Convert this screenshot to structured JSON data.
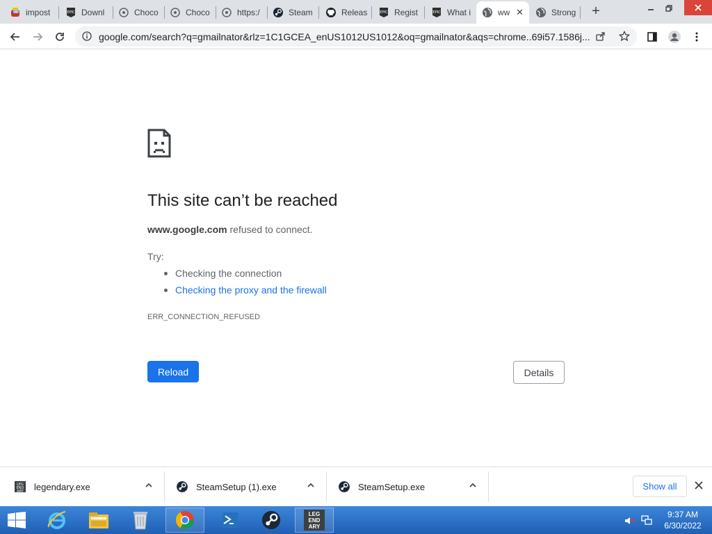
{
  "tabs": [
    {
      "title": "impost",
      "icon": "among-us-icon"
    },
    {
      "title": "Downl",
      "icon": "epic-games-icon"
    },
    {
      "title": "Choco",
      "icon": "chocolatey-icon"
    },
    {
      "title": "Choco",
      "icon": "chocolatey-icon"
    },
    {
      "title": "https:/",
      "icon": "chocolatey-icon"
    },
    {
      "title": "Steam",
      "icon": "steam-icon"
    },
    {
      "title": "Releas",
      "icon": "github-icon"
    },
    {
      "title": "Regist",
      "icon": "epic-games-icon"
    },
    {
      "title": "What i",
      "icon": "epic-games-icon"
    },
    {
      "title": "ww",
      "icon": "globe-icon",
      "active": true
    },
    {
      "title": "Strong",
      "icon": "globe-icon"
    }
  ],
  "address_bar": {
    "url": "google.com/search?q=gmailnator&rlz=1C1GCEA_enUS1012US1012&oq=gmailnator&aqs=chrome..69i57.1586j..."
  },
  "error": {
    "title": "This site can’t be reached",
    "host": "www.google.com",
    "message": "refused to connect.",
    "try_label": "Try:",
    "suggestions": [
      {
        "text": "Checking the connection",
        "link": false
      },
      {
        "text": "Checking the proxy and the firewall",
        "link": true
      }
    ],
    "code": "ERR_CONNECTION_REFUSED",
    "reload_label": "Reload",
    "details_label": "Details"
  },
  "downloads": {
    "items": [
      {
        "name": "legendary.exe",
        "icon": "legendary-icon"
      },
      {
        "name": "SteamSetup (1).exe",
        "icon": "steam-icon"
      },
      {
        "name": "SteamSetup.exe",
        "icon": "steam-icon"
      }
    ],
    "show_all_label": "Show all"
  },
  "taskbar": {
    "apps": [
      "internet-explorer-icon",
      "file-explorer-icon",
      "recycle-bin-icon",
      "chrome-icon",
      "powershell-icon",
      "steam-icon",
      "legendary-icon"
    ],
    "legendary_text": "LEG END ARY",
    "time": "9:37 AM",
    "date": "6/30/2022"
  },
  "colors": {
    "accent": "#1a73e8",
    "taskbar": "#2a6fc9",
    "close": "#d9453a"
  }
}
